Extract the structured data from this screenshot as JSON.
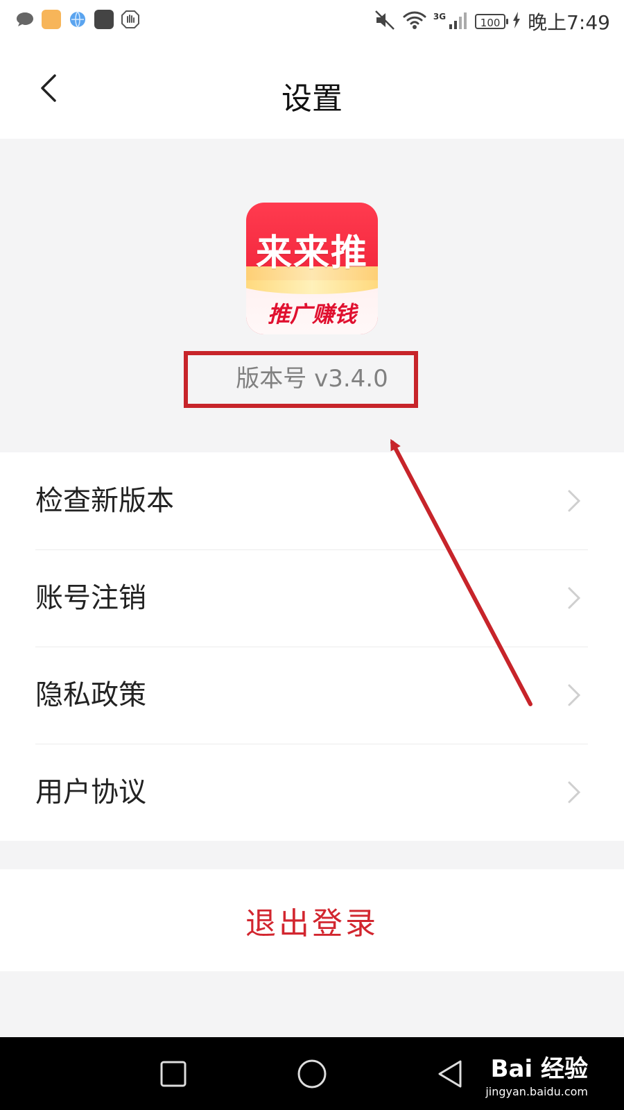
{
  "status_bar": {
    "network": "3G",
    "battery": "100",
    "time": "晚上7:49",
    "left_icons": [
      "chat-bubble-icon",
      "orange-app-icon",
      "globe-icon",
      "huawei-app-icon",
      "hand-stop-icon"
    ],
    "right_icons": [
      "mute-icon",
      "wifi-icon",
      "signal-icon",
      "charging-icon"
    ]
  },
  "header": {
    "title": "设置",
    "back_icon": "chevron-left-icon"
  },
  "app_info": {
    "logo_text_top": "来来推",
    "logo_text_bottom": "推广赚钱",
    "version": "版本号 v3.4.0",
    "highlight_color": "#c7242a"
  },
  "menu": {
    "items": [
      {
        "label": "检查新版本"
      },
      {
        "label": "账号注销"
      },
      {
        "label": "隐私政策"
      },
      {
        "label": "用户协议"
      }
    ]
  },
  "logout": {
    "label": "退出登录",
    "color": "#d2262f"
  },
  "nav_bar": {
    "buttons": [
      "square-icon",
      "circle-icon",
      "back-triangle-icon"
    ]
  },
  "watermark": {
    "brand": "Bai 经验",
    "url": "jingyan.baidu.com"
  }
}
